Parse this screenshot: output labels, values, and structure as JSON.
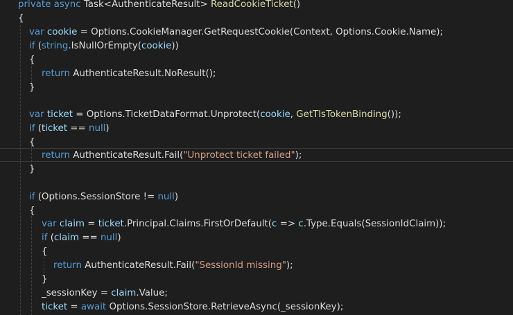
{
  "editor": {
    "language": "csharp",
    "colors": {
      "background": "#1e1e1e",
      "keyword": "#569cd6",
      "type": "#4ec9b0",
      "method": "#dcdcaa",
      "string": "#d69d85",
      "local": "#9cdcfe",
      "text": "#dcdcdc"
    },
    "lines": [
      {
        "tokens": [
          {
            "t": "private",
            "c": "keyword"
          },
          {
            "t": " "
          },
          {
            "t": "async",
            "c": "keyword"
          },
          {
            "t": " Task<AuthenticateResult> "
          },
          {
            "t": "ReadCookieTicket",
            "c": "method"
          },
          {
            "t": "()"
          }
        ]
      },
      {
        "tokens": [
          {
            "t": "{"
          }
        ]
      },
      {
        "tokens": [
          {
            "t": "var",
            "c": "keyword"
          },
          {
            "t": " "
          },
          {
            "t": "cookie",
            "c": "local"
          },
          {
            "t": " = Options.CookieManager.GetRequestCookie(Context, Options.Cookie.Name);"
          }
        ]
      },
      {
        "tokens": [
          {
            "t": "if",
            "c": "keyword"
          },
          {
            "t": " ("
          },
          {
            "t": "string",
            "c": "keyword"
          },
          {
            "t": ".IsNullOrEmpty("
          },
          {
            "t": "cookie",
            "c": "local"
          },
          {
            "t": "))"
          }
        ]
      },
      {
        "tokens": [
          {
            "t": "{"
          }
        ]
      },
      {
        "tokens": [
          {
            "t": "return",
            "c": "keyword"
          },
          {
            "t": " AuthenticateResult.NoResult();"
          }
        ]
      },
      {
        "tokens": [
          {
            "t": "}"
          }
        ]
      },
      {
        "tokens": []
      },
      {
        "tokens": [
          {
            "t": "var",
            "c": "keyword"
          },
          {
            "t": " "
          },
          {
            "t": "ticket",
            "c": "local"
          },
          {
            "t": " = Options.TicketDataFormat.Unprotect("
          },
          {
            "t": "cookie",
            "c": "local"
          },
          {
            "t": ", "
          },
          {
            "t": "GetTlsTokenBinding",
            "c": "method"
          },
          {
            "t": "());"
          }
        ]
      },
      {
        "tokens": [
          {
            "t": "if",
            "c": "keyword"
          },
          {
            "t": " ("
          },
          {
            "t": "ticket",
            "c": "local"
          },
          {
            "t": " == "
          },
          {
            "t": "null",
            "c": "keyword"
          },
          {
            "t": ")"
          }
        ]
      },
      {
        "tokens": [
          {
            "t": "{"
          }
        ]
      },
      {
        "tokens": [
          {
            "t": "return",
            "c": "keyword"
          },
          {
            "t": " AuthenticateResult.Fail("
          },
          {
            "t": "\"Unprotect ticket failed\"",
            "c": "string"
          },
          {
            "t": ");"
          }
        ]
      },
      {
        "tokens": [
          {
            "t": "}"
          }
        ]
      },
      {
        "tokens": []
      },
      {
        "tokens": [
          {
            "t": "if",
            "c": "keyword"
          },
          {
            "t": " (Options.SessionStore != "
          },
          {
            "t": "null",
            "c": "keyword"
          },
          {
            "t": ")"
          }
        ]
      },
      {
        "tokens": [
          {
            "t": "{"
          }
        ]
      },
      {
        "tokens": [
          {
            "t": "var",
            "c": "keyword"
          },
          {
            "t": " "
          },
          {
            "t": "claim",
            "c": "local"
          },
          {
            "t": " = "
          },
          {
            "t": "ticket",
            "c": "local"
          },
          {
            "t": ".Principal.Claims.FirstOrDefault("
          },
          {
            "t": "c",
            "c": "local"
          },
          {
            "t": " => "
          },
          {
            "t": "c",
            "c": "local"
          },
          {
            "t": ".Type.Equals(SessionIdClaim));"
          }
        ]
      },
      {
        "tokens": [
          {
            "t": "if",
            "c": "keyword"
          },
          {
            "t": " ("
          },
          {
            "t": "claim",
            "c": "local"
          },
          {
            "t": " == "
          },
          {
            "t": "null",
            "c": "keyword"
          },
          {
            "t": ")"
          }
        ]
      },
      {
        "tokens": [
          {
            "t": "{"
          }
        ]
      },
      {
        "tokens": [
          {
            "t": "return",
            "c": "keyword"
          },
          {
            "t": " AuthenticateResult.Fail("
          },
          {
            "t": "\"SessionId missing\"",
            "c": "string"
          },
          {
            "t": ");"
          }
        ]
      },
      {
        "tokens": [
          {
            "t": "}"
          }
        ]
      },
      {
        "tokens": [
          {
            "t": "_sessionKey = "
          },
          {
            "t": "claim",
            "c": "local"
          },
          {
            "t": ".Value;"
          }
        ]
      },
      {
        "tokens": [
          {
            "t": "ticket",
            "c": "local"
          },
          {
            "t": " = "
          },
          {
            "t": "await",
            "c": "keyword"
          },
          {
            "t": " Options.SessionStore.RetrieveAsync(_sessionKey);"
          }
        ]
      }
    ]
  }
}
